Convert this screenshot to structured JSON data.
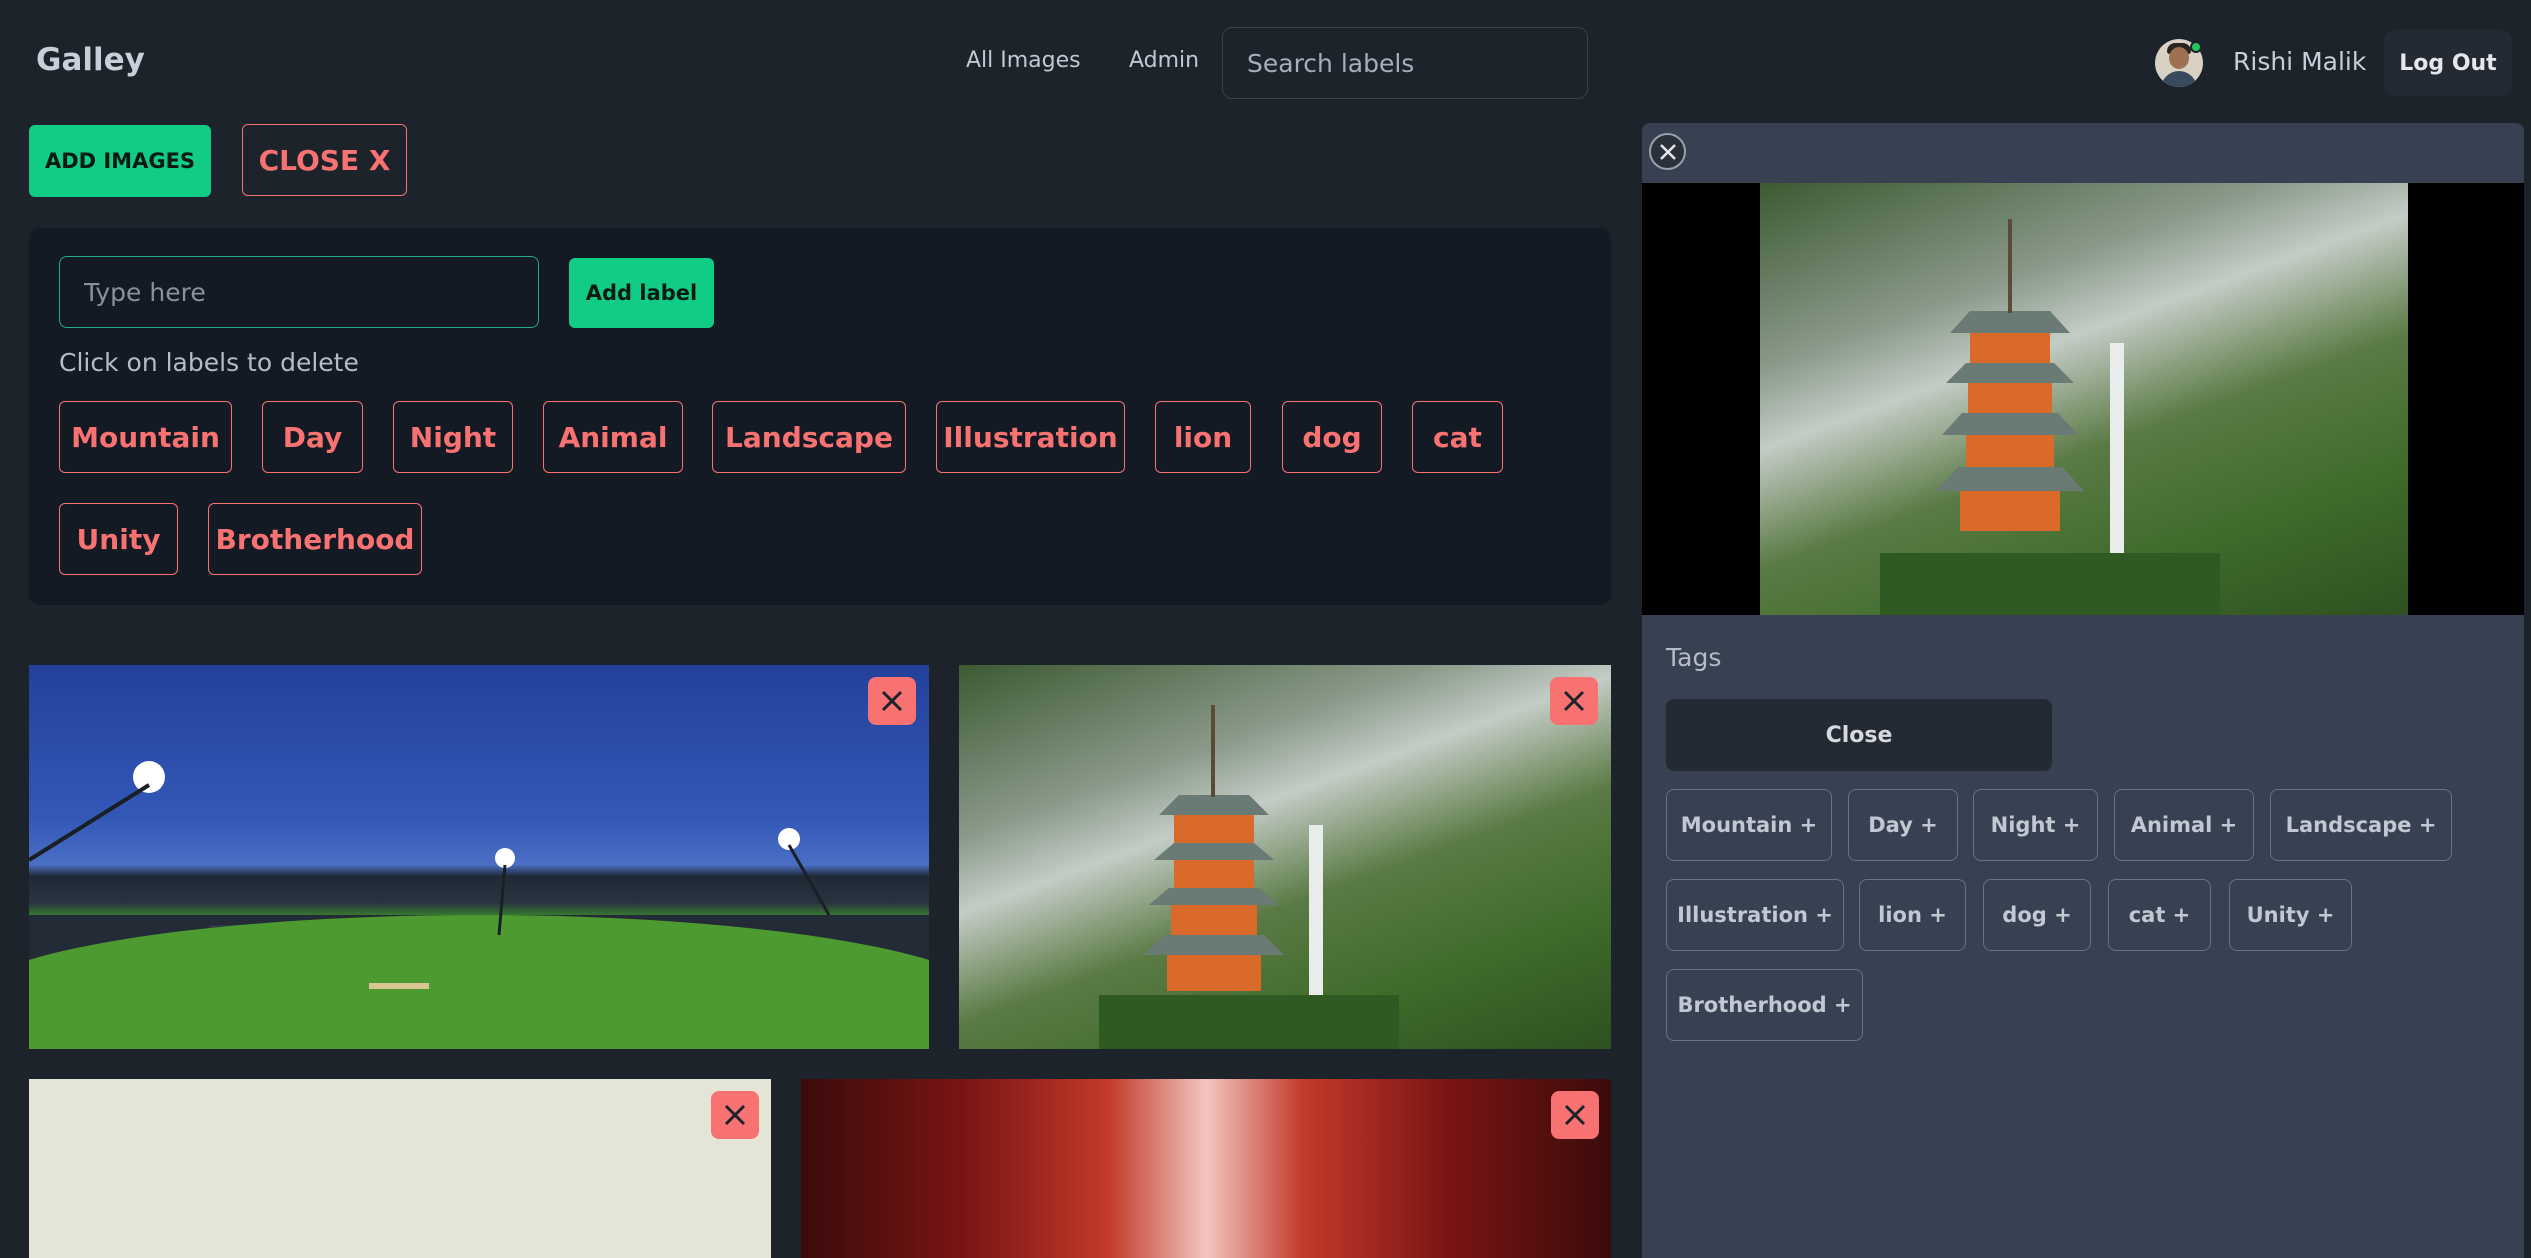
{
  "navbar": {
    "brand": "Galley",
    "links": [
      "All Images",
      "Admin"
    ],
    "search_placeholder": "Search labels",
    "user_name": "Rishi Malik",
    "logout_label": "Log Out"
  },
  "toolbar": {
    "add_images_label": "ADD IMAGES",
    "close_label": "CLOSE X"
  },
  "label_panel": {
    "input_placeholder": "Type here",
    "add_label_button": "Add label",
    "hint": "Click on labels to delete",
    "labels": [
      "Mountain",
      "Day",
      "Night",
      "Animal",
      "Landscape",
      "Illustration",
      "lion",
      "dog",
      "cat",
      "Unity",
      "Brotherhood"
    ]
  },
  "gallery": {
    "images": [
      "cricket-stadium-night",
      "pagoda-waterfall",
      "pale-illustration",
      "red-fire-illustration"
    ]
  },
  "side_panel": {
    "tags_title": "Tags",
    "close_button": "Close",
    "tags": [
      "Mountain +",
      "Day +",
      "Night +",
      "Animal +",
      "Landscape +",
      "Illustration +",
      "lion +",
      "dog +",
      "cat +",
      "Unity +",
      "Brotherhood +"
    ]
  },
  "colors": {
    "accent_green": "#10cc85",
    "danger_red": "#f87272",
    "background": "#1d232a",
    "panel": "#141a24",
    "side_panel": "#374151"
  },
  "icons": [
    "close-icon",
    "avatar",
    "online-status-dot"
  ]
}
